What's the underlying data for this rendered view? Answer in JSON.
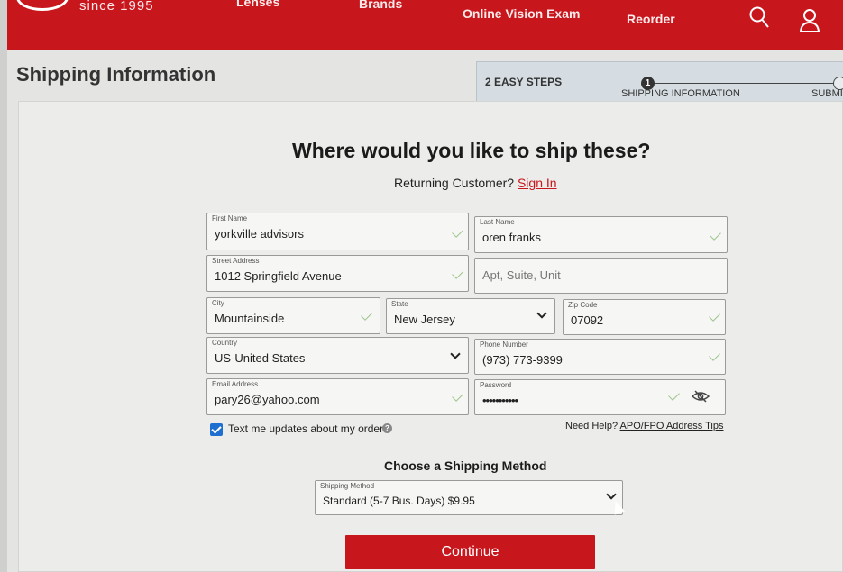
{
  "header": {
    "since": "since 1995",
    "nav": {
      "lenses": "Lenses",
      "brands": "Brands",
      "exam": "Online Vision Exam",
      "reorder": "Reorder"
    },
    "brand_color": "#c8161d"
  },
  "page": {
    "title": "Shipping Information",
    "steps": {
      "label": "2 EASY STEPS",
      "step1_number": "1",
      "step1": "SHIPPING INFORMATION",
      "step2": "SUBMIT"
    }
  },
  "form": {
    "headline": "Where would you like to ship these?",
    "returning_text": "Returning Customer?",
    "sign_in": "Sign In",
    "first_name": {
      "label": "First Name",
      "value": "yorkville advisors"
    },
    "last_name": {
      "label": "Last Name",
      "value": "oren franks"
    },
    "street": {
      "label": "Street Address",
      "value": "1012 Springfield Avenue"
    },
    "apt": {
      "placeholder": "Apt, Suite, Unit"
    },
    "city": {
      "label": "City",
      "value": "Mountainside"
    },
    "state": {
      "label": "State",
      "value": "New Jersey"
    },
    "zip": {
      "label": "Zip Code",
      "value": "07092"
    },
    "country": {
      "label": "Country",
      "value": "US-United States"
    },
    "phone": {
      "label": "Phone Number",
      "value": "(973) 773-9399"
    },
    "email": {
      "label": "Email Address",
      "value": "pary26@yahoo.com"
    },
    "password": {
      "label": "Password",
      "value": "•••••••••••"
    },
    "sms_opt_in": {
      "label": "Text me updates about my order",
      "checked": true
    },
    "need_help": "Need Help?",
    "apo_link": "APO/FPO Address Tips",
    "shipping_heading": "Choose a Shipping Method",
    "shipping_method": {
      "label": "Shipping Method",
      "value": "Standard (5-7 Bus. Days) $9.95"
    },
    "continue": "Continue"
  }
}
